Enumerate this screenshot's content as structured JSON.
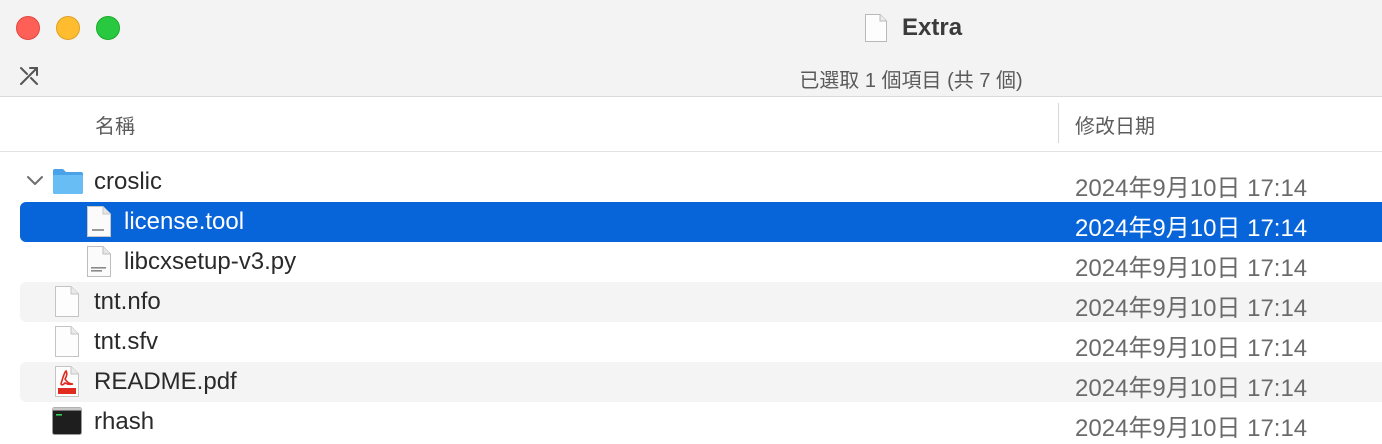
{
  "window": {
    "title": "Extra",
    "status": "已選取 1 個項目 (共 7 個)"
  },
  "columns": {
    "name": "名稱",
    "date_modified": "修改日期"
  },
  "rows": [
    {
      "name": "croslic",
      "date": "2024年9月10日 17:14",
      "icon": "folder-icon",
      "expanded": true,
      "indent": 0
    },
    {
      "name": "license.tool",
      "date": "2024年9月10日 17:14",
      "icon": "tool-file-icon",
      "selected": true,
      "indent": 1
    },
    {
      "name": "libcxsetup-v3.py",
      "date": "2024年9月10日 17:14",
      "icon": "python-file-icon",
      "indent": 1
    },
    {
      "name": "tnt.nfo",
      "date": "2024年9月10日 17:14",
      "icon": "document-icon",
      "indent": 0
    },
    {
      "name": "tnt.sfv",
      "date": "2024年9月10日 17:14",
      "icon": "document-icon",
      "indent": 0
    },
    {
      "name": "README.pdf",
      "date": "2024年9月10日 17:14",
      "icon": "pdf-icon",
      "indent": 0
    },
    {
      "name": "rhash",
      "date": "2024年9月10日 17:14",
      "icon": "terminal-executable-icon",
      "indent": 0
    }
  ],
  "colors": {
    "selection": "#0864d9",
    "alt_row": "#f4f4f4",
    "folder": "#5ab4f2",
    "close": "#fe5f57",
    "minimize": "#febc2e",
    "zoom": "#28c840"
  }
}
